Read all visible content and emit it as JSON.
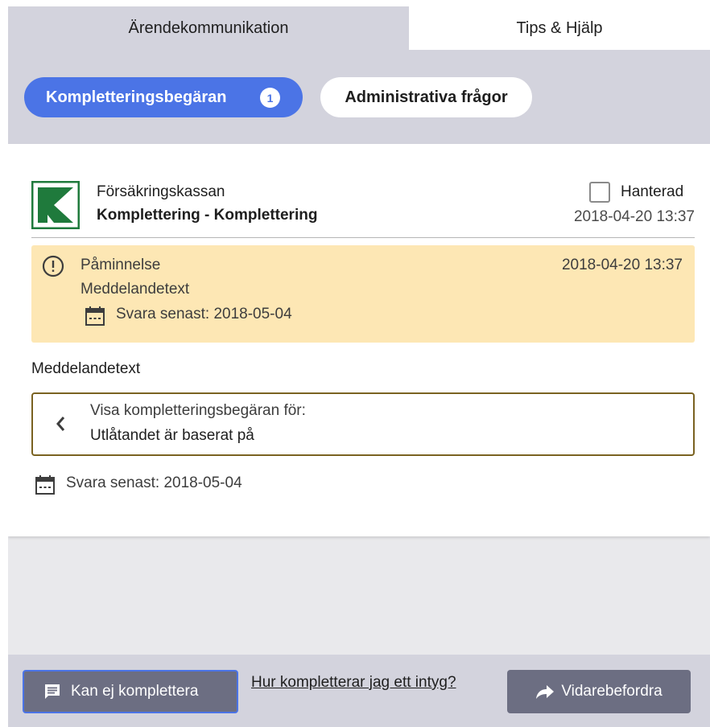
{
  "tabs": {
    "active_label": "Ärendekommunikation",
    "inactive_label": "Tips & Hjälp"
  },
  "filters": {
    "primary_label": "Kompletteringsbegäran",
    "primary_count": "1",
    "secondary_label": "Administrativa frågor"
  },
  "message": {
    "sender": "Försäkringskassan",
    "subject": "Komplettering - Komplettering",
    "handled_label": "Hanterad",
    "handled_checked": false,
    "date": "2018-04-20 13:37",
    "logo_icon": "forsakringskassan-logo",
    "reminder": {
      "icon": "warning-circle-icon",
      "title": "Påminnelse",
      "date": "2018-04-20 13:37",
      "text": "Meddelandetext",
      "deadline_icon": "calendar-icon",
      "deadline": "Svara senast: 2018-05-04"
    },
    "body_text": "Meddelandetext",
    "show_request": {
      "icon": "chevron-left-icon",
      "line1": "Visa kompletteringsbegäran för:",
      "line2": "Utlåtandet är baserat på"
    },
    "deadline_icon": "calendar-icon",
    "deadline": "Svara senast: 2018-05-04"
  },
  "footer": {
    "cannot_label": "Kan ej komplettera",
    "cannot_icon": "message-icon",
    "help_link": "Hur kompletterar jag ett intyg?",
    "forward_label": "Vidarebefordra",
    "forward_icon": "forward-arrow-icon"
  },
  "colors": {
    "accent": "#4b74e6",
    "tab_band": "#d3d3dd",
    "reminder_bg": "#fde7b4",
    "button_grey": "#6c6e82",
    "logo_green": "#1f7a3c"
  }
}
